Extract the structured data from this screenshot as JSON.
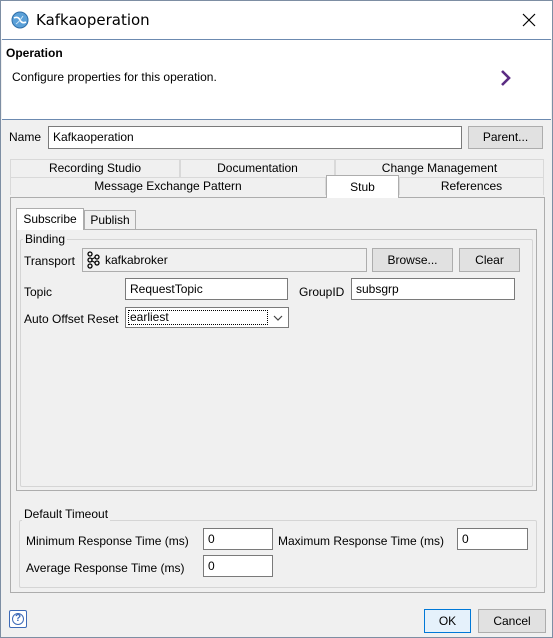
{
  "window": {
    "title": "Kafkaoperation",
    "close_icon": "close-icon",
    "app_icon": "globe-icon"
  },
  "banner": {
    "title": "Operation",
    "description": "Configure properties for this operation.",
    "arrow_icon": "chevron-right-icon",
    "arrow_color": "#5b2c83"
  },
  "name_row": {
    "label": "Name",
    "value": "Kafkaoperation",
    "parent_button": "Parent..."
  },
  "tabs": {
    "row1": [
      "Recording Studio",
      "Documentation",
      "Change Management"
    ],
    "row2": [
      "Message Exchange Pattern",
      "Stub",
      "References"
    ],
    "active": "Stub"
  },
  "subtabs": {
    "items": [
      "Subscribe",
      "Publish"
    ],
    "active": "Subscribe"
  },
  "binding": {
    "group_label": "Binding",
    "transport_label": "Transport",
    "transport_value": "kafkabroker",
    "transport_icon": "kafka-icon",
    "browse_button": "Browse...",
    "clear_button": "Clear",
    "topic_label": "Topic",
    "topic_value": "RequestTopic",
    "groupid_label": "GroupID",
    "groupid_value": "subsgrp",
    "auto_offset_label": "Auto Offset Reset",
    "auto_offset_value": "earliest"
  },
  "timeout": {
    "group_label": "Default Timeout",
    "min_label": "Minimum Response Time (ms)",
    "min_value": "0",
    "max_label": "Maximum Response Time (ms)",
    "max_value": "0",
    "avg_label": "Average Response Time (ms)",
    "avg_value": "0"
  },
  "footer": {
    "help_icon": "help-icon",
    "help_glyph": "?",
    "ok_button": "OK",
    "cancel_button": "Cancel"
  },
  "colors": {
    "accent_border": "#6c8ab0",
    "button_focus": "#0078d7"
  }
}
